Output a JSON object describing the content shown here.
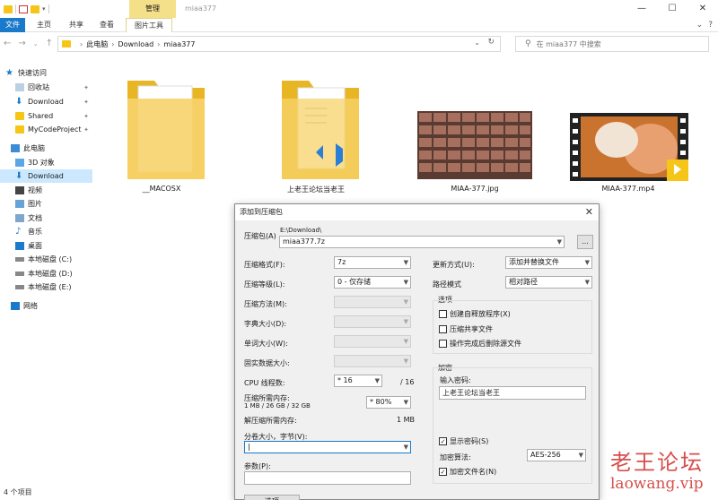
{
  "window": {
    "title": "miaa377",
    "context_tab": "管理",
    "controls": [
      "—",
      "☐",
      "✕"
    ]
  },
  "ribbon": {
    "tabs": [
      "文件",
      "主页",
      "共享",
      "查看",
      "图片工具"
    ],
    "right_icons": [
      "⌄",
      "?"
    ]
  },
  "address": {
    "crumbs": [
      "此电脑",
      "Download",
      "miaa377"
    ],
    "search_placeholder": "在 miaa377 中搜索"
  },
  "sidebar": {
    "items": [
      {
        "label": "快速访问",
        "icon": "star-icon"
      },
      {
        "label": "回收站",
        "icon": "recycle-bin-icon",
        "pinned": true
      },
      {
        "label": "Download",
        "icon": "download-icon",
        "pinned": true
      },
      {
        "label": "Shared",
        "icon": "folder-icon",
        "pinned": true
      },
      {
        "label": "MyCodeProject",
        "icon": "folder-icon",
        "pinned": true
      },
      {
        "label": "此电脑",
        "icon": "pc-icon"
      },
      {
        "label": "3D 对象",
        "icon": "3d-objects-icon"
      },
      {
        "label": "Download",
        "icon": "download-icon",
        "selected": true
      },
      {
        "label": "视频",
        "icon": "video-icon"
      },
      {
        "label": "图片",
        "icon": "pictures-icon"
      },
      {
        "label": "文档",
        "icon": "documents-icon"
      },
      {
        "label": "音乐",
        "icon": "music-icon"
      },
      {
        "label": "桌面",
        "icon": "desktop-icon"
      },
      {
        "label": "本地磁盘 (C:)",
        "icon": "disk-icon"
      },
      {
        "label": "本地磁盘 (D:)",
        "icon": "disk-icon"
      },
      {
        "label": "本地磁盘 (E:)",
        "icon": "disk-icon"
      },
      {
        "label": "网络",
        "icon": "network-icon"
      }
    ]
  },
  "files": [
    {
      "name": "__MACOSX",
      "type": "folder"
    },
    {
      "name": "上老王论坛当老王",
      "type": "folder-vscode"
    },
    {
      "name": "MIAA-377.jpg",
      "type": "image"
    },
    {
      "name": "MIAA-377.mp4",
      "type": "video"
    }
  ],
  "status": {
    "count": "4 个项目"
  },
  "dialog": {
    "title": "添加到压缩包",
    "archive_label": "压缩包(A)",
    "archive_path": "E:\\Download\\",
    "archive_name": "miaa377.7z",
    "browse": "...",
    "format_label": "压缩格式(F):",
    "format_value": "7z",
    "level_label": "压缩等级(L):",
    "level_value": "0 - 仅存储",
    "method_label": "压缩方法(M):",
    "dict_label": "字典大小(D):",
    "word_label": "单词大小(W):",
    "solid_label": "固实数据大小:",
    "cpu_label": "CPU 线程数:",
    "cpu_value": "* 16",
    "cpu_total": "/ 16",
    "mem_label": "压缩所需内存:",
    "mem_value": "1 MB / 26 GB / 32 GB",
    "mem_pct": "* 80%",
    "decomp_label": "解压缩所需内存:",
    "decomp_value": "1 MB",
    "volume_label": "分卷大小，字节(V):",
    "params_label": "参数(P):",
    "options_button": "选项",
    "update_label": "更新方式(U):",
    "update_value": "添加并替换文件",
    "path_label": "路径模式",
    "path_value": "相对路径",
    "options_group": "选项",
    "opt_sfx": "创建自释放程序(X)",
    "opt_shared": "压缩共享文件",
    "opt_delete": "操作完成后删除源文件",
    "encrypt_group": "加密",
    "pwd_label": "输入密码:",
    "pwd_value": "上老王论坛当老王",
    "show_pwd": "显示密码(S)",
    "enc_method_label": "加密算法:",
    "enc_method_value": "AES-256",
    "enc_names": "加密文件名(N)"
  },
  "watermark": {
    "line1": "老王论坛",
    "line2": "laowang.vip"
  }
}
